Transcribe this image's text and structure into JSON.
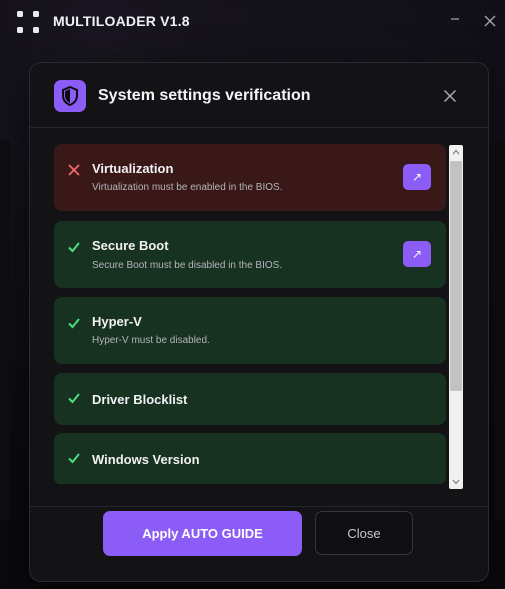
{
  "app": {
    "title": "MULTILOADER V1.8"
  },
  "window_controls": {
    "minimize_icon": "minimize-icon",
    "close_icon": "close-icon"
  },
  "modal": {
    "title": "System settings verification",
    "header_icon": "shield-icon",
    "close_icon": "close-icon"
  },
  "checks": [
    {
      "title": "Virtualization",
      "description": "Virtualization must be enabled in the BIOS.",
      "status": "fail",
      "has_link": true
    },
    {
      "title": "Secure Boot",
      "description": "Secure Boot must be disabled in the BIOS.",
      "status": "pass",
      "has_link": true
    },
    {
      "title": "Hyper-V",
      "description": "Hyper-V must be disabled.",
      "status": "pass",
      "has_link": false
    },
    {
      "title": "Driver Blocklist",
      "description": "",
      "status": "pass",
      "has_link": false
    },
    {
      "title": "Windows Version",
      "description": "",
      "status": "pass",
      "has_link": false
    }
  ],
  "footer": {
    "primary_label": "Apply AUTO GUIDE",
    "secondary_label": "Close"
  },
  "colors": {
    "accent": "#8b5cf6",
    "fail_bg": "#3a1818",
    "pass_bg": "#173220",
    "fail_icon": "#f06a6a",
    "pass_icon": "#4ade80"
  }
}
